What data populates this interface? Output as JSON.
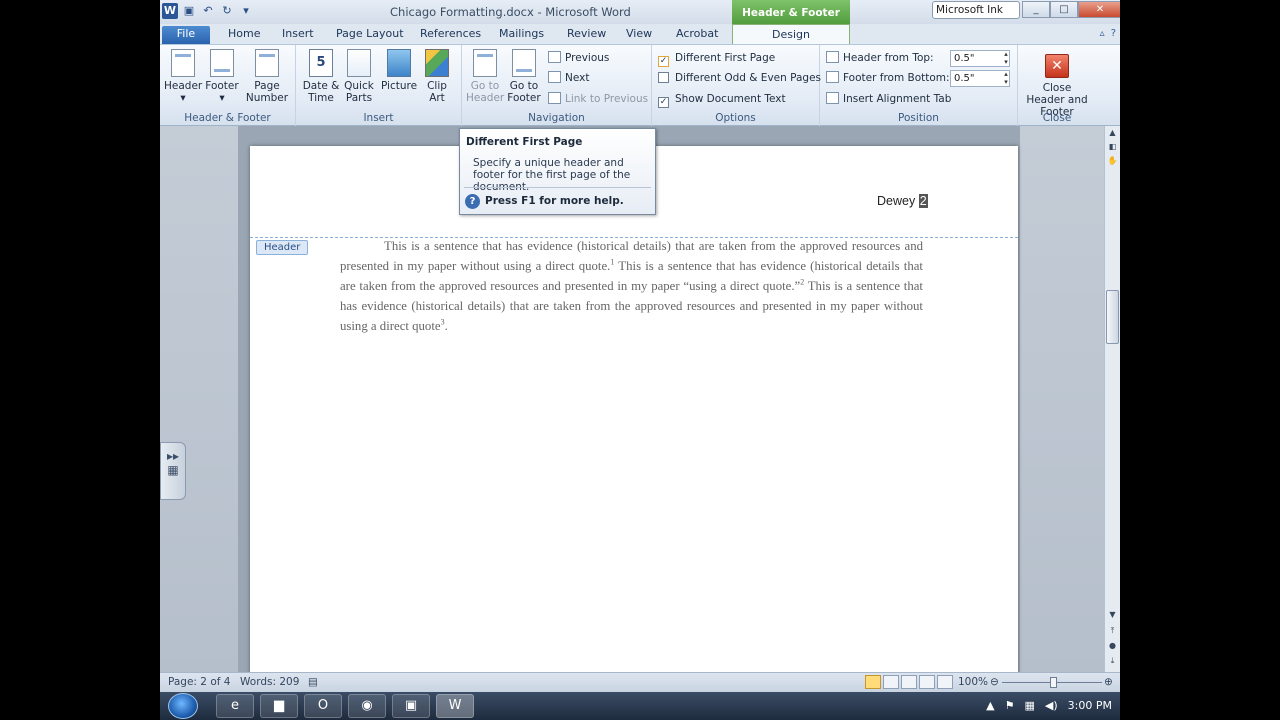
{
  "window": {
    "title": "Chicago Formatting.docx - Microsoft Word",
    "context_tab_group": "Header & Footer Tools",
    "ink_label": "Microsoft Ink",
    "min": "_",
    "max": "□",
    "close": "✕"
  },
  "tabs": [
    "File",
    "Home",
    "Insert",
    "Page Layout",
    "References",
    "Mailings",
    "Review",
    "View",
    "Acrobat",
    "Design"
  ],
  "ribbon": {
    "header_footer": {
      "label": "Header & Footer",
      "header": "Header",
      "footer": "Footer",
      "page_number": "Page Number"
    },
    "insert": {
      "label": "Insert",
      "date_time": "Date & Time",
      "quick_parts": "Quick Parts",
      "picture": "Picture",
      "clip_art": "Clip Art"
    },
    "navigation": {
      "label": "Navigation",
      "go_to_header": "Go to Header",
      "go_to_footer": "Go to Footer",
      "previous": "Previous",
      "next": "Next",
      "link_to_previous": "Link to Previous"
    },
    "options": {
      "label": "Options",
      "different_first_page": "Different First Page",
      "different_odd_even": "Different Odd & Even Pages",
      "show_document_text": "Show Document Text",
      "first_checked": true,
      "odd_even_checked": false,
      "show_checked": true
    },
    "position": {
      "label": "Position",
      "header_from_top": "Header from Top:",
      "header_from_top_value": "0.5\"",
      "footer_from_bottom": "Footer from Bottom:",
      "footer_from_bottom_value": "0.5\"",
      "insert_alignment_tab": "Insert Alignment Tab"
    },
    "close": {
      "label": "Close",
      "close_header_footer": "Close Header and Footer"
    }
  },
  "tooltip": {
    "title": "Different First Page",
    "description": "Specify a unique header and footer for the first page of the document.",
    "help": "Press F1 for more help."
  },
  "document": {
    "header_text": "Dewey",
    "page_number": "2",
    "header_tag": "Header",
    "p1": "This is a sentence that has evidence (historical details) that are taken from the approved resources and presented in my paper without using a direct quote.",
    "fn1": "1",
    "p2": " This is a sentence that has evidence (historical  details that are taken from the approved resources and presented in my paper “using a direct quote.”",
    "fn2": "2",
    "p3": "  This is a sentence that has evidence (historical  details) that are taken from the approved resources  and presented in my paper without using a direct quote",
    "fn3": "3",
    "p3_end": "."
  },
  "status": {
    "page": "Page: 2 of 4",
    "words": "Words: 209",
    "zoom": "100%"
  },
  "taskbar": {
    "time": "3:00 PM"
  }
}
